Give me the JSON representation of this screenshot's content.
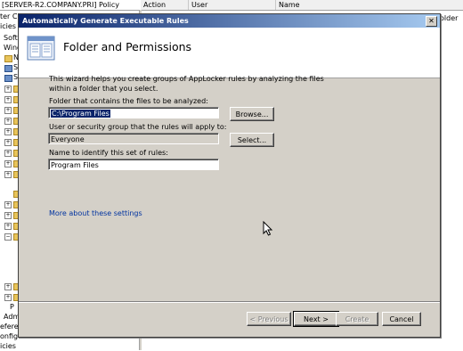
{
  "background": {
    "window_title": "[SERVER-R2.COMPANY.PRI] Policy",
    "columns": [
      "Action",
      "User",
      "Name"
    ],
    "tree_fragments": [
      "ter Co",
      "icies",
      "Softw",
      "Wind",
      "N",
      "S",
      "S",
      "P",
      "Admi",
      "eferen",
      "onfiguration",
      "icies"
    ],
    "right_fragment": "older"
  },
  "dialog": {
    "title": "Automatically Generate Executable Rules",
    "close_glyph": "✕",
    "header_title": "Folder and Permissions",
    "intro_text": "This wizard helps you create groups of AppLocker rules by analyzing the files within a folder that you select.",
    "folder_label": "Folder that contains the files to be analyzed:",
    "folder_value": "C:\\Program Files",
    "browse_label": "Browse...",
    "user_label": "User or security group that the rules will apply to:",
    "user_value": "Everyone",
    "select_label": "Select...",
    "name_label": "Name to identify this set of rules:",
    "name_value": "Program Files",
    "more_link": "More about these settings",
    "buttons": {
      "previous": "< Previous",
      "next": "Next >",
      "create": "Create",
      "cancel": "Cancel"
    }
  },
  "colors": {
    "titlebar_start": "#0a246a",
    "titlebar_end": "#a6caf0",
    "dialog_face": "#d4d0c8",
    "link": "#0033a0"
  }
}
